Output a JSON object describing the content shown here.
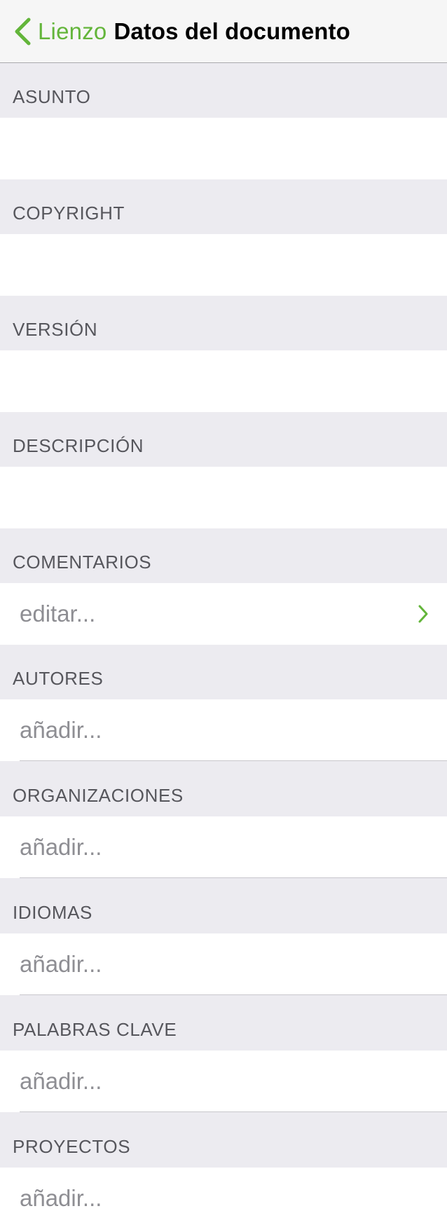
{
  "nav": {
    "back_label": "Lienzo",
    "title": "Datos del documento"
  },
  "colors": {
    "accent": "#63b53a",
    "group_background": "#ecebf0",
    "header_text": "#56565c",
    "placeholder_text": "#8e8e93"
  },
  "sections": [
    {
      "header": "ASUNTO",
      "row": ""
    },
    {
      "header": "COPYRIGHT",
      "row": ""
    },
    {
      "header": "VERSIÓN",
      "row": ""
    },
    {
      "header": "DESCRIPCIÓN",
      "row": ""
    },
    {
      "header": "COMENTARIOS",
      "row": "editar..."
    },
    {
      "header": "AUTORES",
      "row": "añadir..."
    },
    {
      "header": "ORGANIZACIONES",
      "row": "añadir..."
    },
    {
      "header": "IDIOMAS",
      "row": "añadir..."
    },
    {
      "header": "PALABRAS CLAVE",
      "row": "añadir..."
    },
    {
      "header": "PROYECTOS",
      "row": "añadir..."
    }
  ],
  "icons": {
    "back": "chevron-left-icon",
    "disclosure": "chevron-right-icon"
  }
}
